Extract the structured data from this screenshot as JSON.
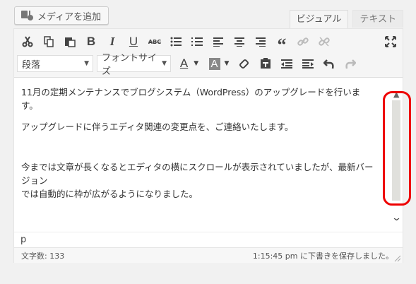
{
  "media": {
    "add_label": "メディアを追加"
  },
  "tabs": [
    {
      "label": "ビジュアル"
    },
    {
      "label": "テキスト"
    }
  ],
  "toolbar": {
    "format_select": "段落",
    "fontsize_select": "フォントサイズ",
    "text_color_glyph": "A",
    "bg_color_glyph": "A"
  },
  "content": {
    "para1": "11月の定期メンテナンスでブログシステム（WordPress）のアップグレードを行います。",
    "para2": "アップグレードに伴うエディタ関連の変更点を、ご連絡いたします。",
    "para3_line1": "今までは文章が長くなるとエディタの横にスクロールが表示されていましたが、最新バージョン",
    "para3_line2": "では自動的に枠が広がるようになりました。"
  },
  "path_bar": "p",
  "status": {
    "word_count": "文字数: 133",
    "draft_saved": "1:15:45 pm に下書きを保存しました。"
  },
  "colors": {
    "highlight": "#ee0000",
    "scroll_track": "#e0e0dc"
  }
}
